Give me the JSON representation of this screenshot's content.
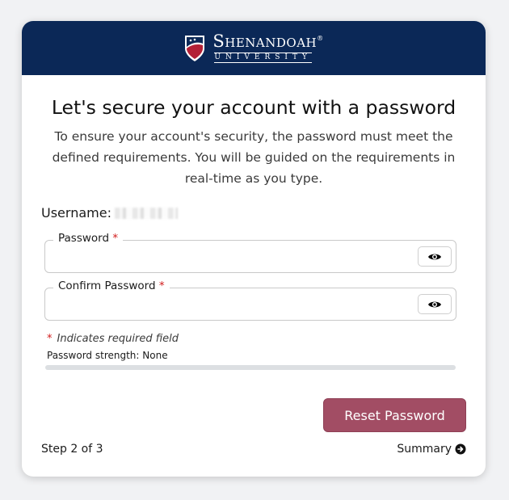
{
  "header": {
    "logo_main": "Shenandoah",
    "logo_registered": "®",
    "logo_sub": "UNIVERSITY",
    "brand_color": "#0b2857"
  },
  "page": {
    "title": "Let's secure your account with a password",
    "subtitle": "To ensure your account's security, the password must meet the defined requirements. You will be guided on the requirements in real-time as you type."
  },
  "username": {
    "label": "Username:"
  },
  "fields": {
    "password": {
      "label": "Password",
      "required_mark": "*",
      "value": ""
    },
    "confirm_password": {
      "label": "Confirm Password",
      "required_mark": "*",
      "value": ""
    }
  },
  "required_note": {
    "mark": "*",
    "text": "Indicates required field"
  },
  "strength": {
    "label": "Password strength: None",
    "level": 0
  },
  "actions": {
    "reset_label": "Reset Password",
    "accent_color": "#a24d64"
  },
  "footer": {
    "step_text": "Step 2 of 3",
    "summary_label": "Summary"
  },
  "icons": {
    "toggle_visibility": "eye-icon",
    "summary_arrow": "arrow-circle-right-icon",
    "logo": "shield-icon"
  }
}
